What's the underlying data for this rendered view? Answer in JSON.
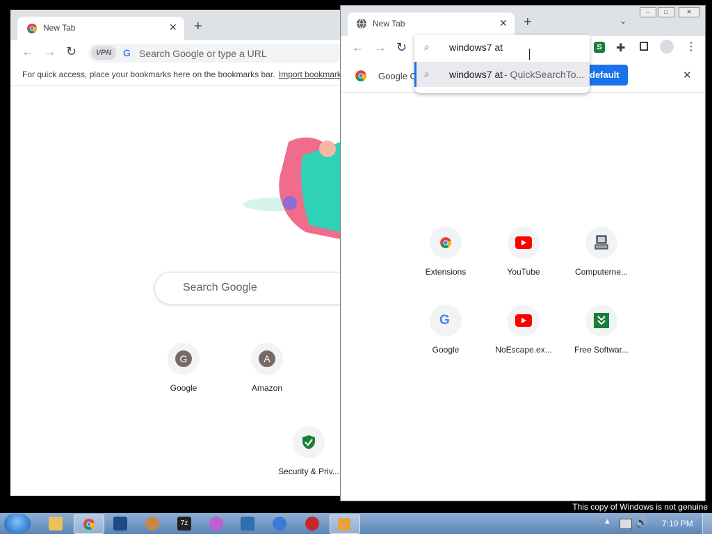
{
  "left_browser": {
    "tab_title": "New Tab",
    "vpn_label": "VPN",
    "omnibox_placeholder": "Search Google or type a URL",
    "bookmarks_hint": "For quick access, place your bookmarks here on the bookmarks bar.",
    "import_link": "Import bookmark",
    "ntp_search_placeholder": "Search Google",
    "shortcuts": [
      {
        "label": "Google",
        "letter": "G",
        "color": "#7a6a66"
      },
      {
        "label": "Amazon",
        "letter": "A",
        "color": "#7a6a66"
      },
      {
        "label": "Security & Priv...",
        "icon": "shield-check-icon"
      }
    ]
  },
  "right_browser": {
    "tab_title": "New Tab",
    "omnibox_value": "windows7 at",
    "suggestion_query": "windows7 at",
    "suggestion_source": " - QuickSearchTo...",
    "infobar_text": "Google C",
    "infobar_button": "default",
    "shortcuts": [
      {
        "label": "Extensions",
        "icon": "chrome-icon"
      },
      {
        "label": "YouTube",
        "icon": "youtube-icon"
      },
      {
        "label": "Computerne...",
        "icon": "computer-icon"
      },
      {
        "label": "Google",
        "icon": "google-g-icon"
      },
      {
        "label": "NoEscape.ex...",
        "icon": "youtube-icon"
      },
      {
        "label": "Free Softwar...",
        "icon": "download-icon"
      }
    ]
  },
  "windows": {
    "genuine_notice": "This copy of Windows is not genuine",
    "clock": "7:10 PM",
    "taskbar_7z": "7z"
  },
  "colors": {
    "accent": "#1a73e8",
    "youtube": "#ff0000",
    "shield": "#188038"
  }
}
